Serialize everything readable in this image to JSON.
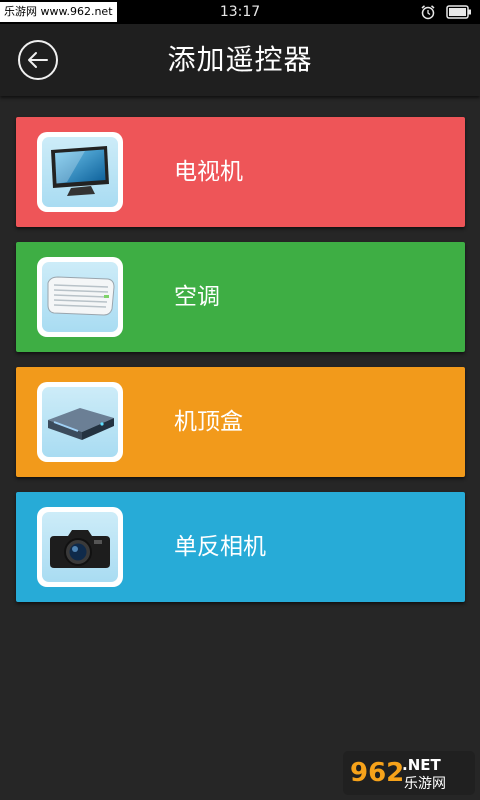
{
  "status_bar": {
    "watermark": "乐游网 www.962.net",
    "time": "13:17"
  },
  "header": {
    "title": "添加遥控器",
    "back_icon": "back-arrow-icon"
  },
  "devices": [
    {
      "label": "电视机",
      "icon": "tv-icon",
      "color": "#ee5558"
    },
    {
      "label": "空调",
      "icon": "air-conditioner-icon",
      "color": "#3eae44"
    },
    {
      "label": "机顶盒",
      "icon": "set-top-box-icon",
      "color": "#f29a1b"
    },
    {
      "label": "单反相机",
      "icon": "dslr-camera-icon",
      "color": "#27abd7"
    }
  ],
  "watermark_logo": {
    "number": "962",
    "suffix": ".NET",
    "site": "乐游网"
  }
}
